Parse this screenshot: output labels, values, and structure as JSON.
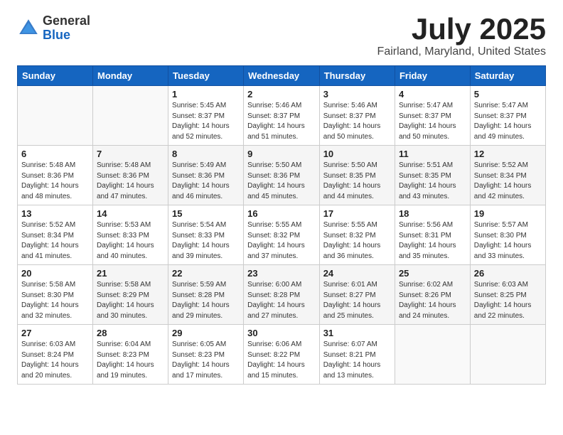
{
  "header": {
    "logo_general": "General",
    "logo_blue": "Blue",
    "month": "July 2025",
    "location": "Fairland, Maryland, United States"
  },
  "weekdays": [
    "Sunday",
    "Monday",
    "Tuesday",
    "Wednesday",
    "Thursday",
    "Friday",
    "Saturday"
  ],
  "weeks": [
    [
      {
        "day": "",
        "info": ""
      },
      {
        "day": "",
        "info": ""
      },
      {
        "day": "1",
        "info": "Sunrise: 5:45 AM\nSunset: 8:37 PM\nDaylight: 14 hours and 52 minutes."
      },
      {
        "day": "2",
        "info": "Sunrise: 5:46 AM\nSunset: 8:37 PM\nDaylight: 14 hours and 51 minutes."
      },
      {
        "day": "3",
        "info": "Sunrise: 5:46 AM\nSunset: 8:37 PM\nDaylight: 14 hours and 50 minutes."
      },
      {
        "day": "4",
        "info": "Sunrise: 5:47 AM\nSunset: 8:37 PM\nDaylight: 14 hours and 50 minutes."
      },
      {
        "day": "5",
        "info": "Sunrise: 5:47 AM\nSunset: 8:37 PM\nDaylight: 14 hours and 49 minutes."
      }
    ],
    [
      {
        "day": "6",
        "info": "Sunrise: 5:48 AM\nSunset: 8:36 PM\nDaylight: 14 hours and 48 minutes."
      },
      {
        "day": "7",
        "info": "Sunrise: 5:48 AM\nSunset: 8:36 PM\nDaylight: 14 hours and 47 minutes."
      },
      {
        "day": "8",
        "info": "Sunrise: 5:49 AM\nSunset: 8:36 PM\nDaylight: 14 hours and 46 minutes."
      },
      {
        "day": "9",
        "info": "Sunrise: 5:50 AM\nSunset: 8:36 PM\nDaylight: 14 hours and 45 minutes."
      },
      {
        "day": "10",
        "info": "Sunrise: 5:50 AM\nSunset: 8:35 PM\nDaylight: 14 hours and 44 minutes."
      },
      {
        "day": "11",
        "info": "Sunrise: 5:51 AM\nSunset: 8:35 PM\nDaylight: 14 hours and 43 minutes."
      },
      {
        "day": "12",
        "info": "Sunrise: 5:52 AM\nSunset: 8:34 PM\nDaylight: 14 hours and 42 minutes."
      }
    ],
    [
      {
        "day": "13",
        "info": "Sunrise: 5:52 AM\nSunset: 8:34 PM\nDaylight: 14 hours and 41 minutes."
      },
      {
        "day": "14",
        "info": "Sunrise: 5:53 AM\nSunset: 8:33 PM\nDaylight: 14 hours and 40 minutes."
      },
      {
        "day": "15",
        "info": "Sunrise: 5:54 AM\nSunset: 8:33 PM\nDaylight: 14 hours and 39 minutes."
      },
      {
        "day": "16",
        "info": "Sunrise: 5:55 AM\nSunset: 8:32 PM\nDaylight: 14 hours and 37 minutes."
      },
      {
        "day": "17",
        "info": "Sunrise: 5:55 AM\nSunset: 8:32 PM\nDaylight: 14 hours and 36 minutes."
      },
      {
        "day": "18",
        "info": "Sunrise: 5:56 AM\nSunset: 8:31 PM\nDaylight: 14 hours and 35 minutes."
      },
      {
        "day": "19",
        "info": "Sunrise: 5:57 AM\nSunset: 8:30 PM\nDaylight: 14 hours and 33 minutes."
      }
    ],
    [
      {
        "day": "20",
        "info": "Sunrise: 5:58 AM\nSunset: 8:30 PM\nDaylight: 14 hours and 32 minutes."
      },
      {
        "day": "21",
        "info": "Sunrise: 5:58 AM\nSunset: 8:29 PM\nDaylight: 14 hours and 30 minutes."
      },
      {
        "day": "22",
        "info": "Sunrise: 5:59 AM\nSunset: 8:28 PM\nDaylight: 14 hours and 29 minutes."
      },
      {
        "day": "23",
        "info": "Sunrise: 6:00 AM\nSunset: 8:28 PM\nDaylight: 14 hours and 27 minutes."
      },
      {
        "day": "24",
        "info": "Sunrise: 6:01 AM\nSunset: 8:27 PM\nDaylight: 14 hours and 25 minutes."
      },
      {
        "day": "25",
        "info": "Sunrise: 6:02 AM\nSunset: 8:26 PM\nDaylight: 14 hours and 24 minutes."
      },
      {
        "day": "26",
        "info": "Sunrise: 6:03 AM\nSunset: 8:25 PM\nDaylight: 14 hours and 22 minutes."
      }
    ],
    [
      {
        "day": "27",
        "info": "Sunrise: 6:03 AM\nSunset: 8:24 PM\nDaylight: 14 hours and 20 minutes."
      },
      {
        "day": "28",
        "info": "Sunrise: 6:04 AM\nSunset: 8:23 PM\nDaylight: 14 hours and 19 minutes."
      },
      {
        "day": "29",
        "info": "Sunrise: 6:05 AM\nSunset: 8:23 PM\nDaylight: 14 hours and 17 minutes."
      },
      {
        "day": "30",
        "info": "Sunrise: 6:06 AM\nSunset: 8:22 PM\nDaylight: 14 hours and 15 minutes."
      },
      {
        "day": "31",
        "info": "Sunrise: 6:07 AM\nSunset: 8:21 PM\nDaylight: 14 hours and 13 minutes."
      },
      {
        "day": "",
        "info": ""
      },
      {
        "day": "",
        "info": ""
      }
    ]
  ]
}
